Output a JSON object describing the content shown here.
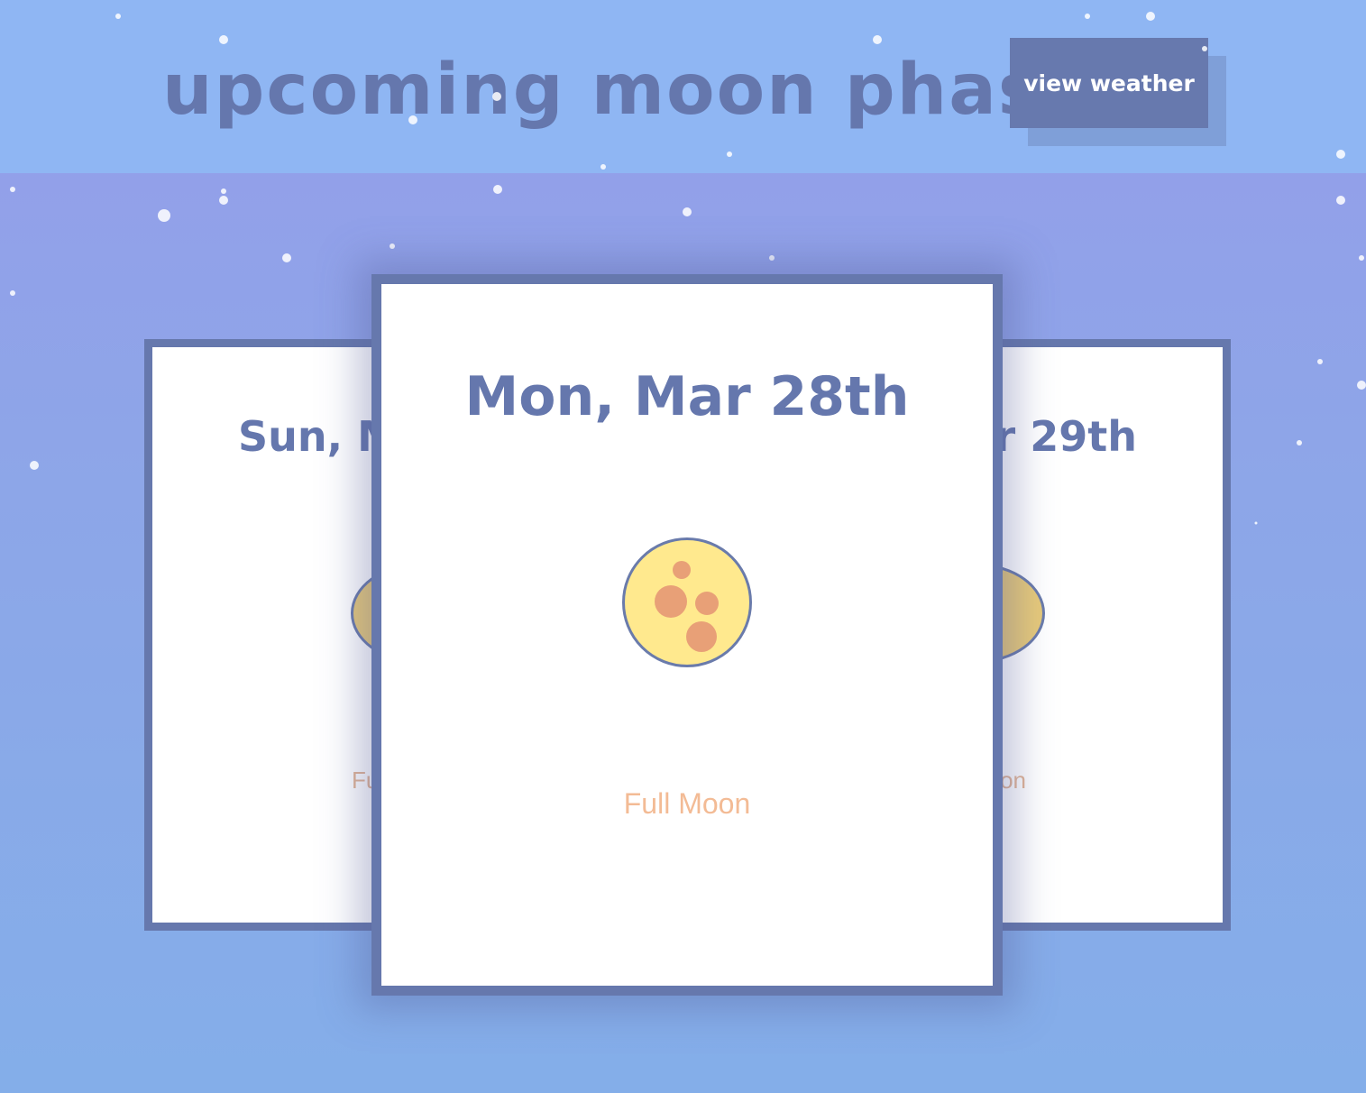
{
  "header": {
    "title": "upcoming moon phases",
    "button_label": "view weather"
  },
  "cards": {
    "left": {
      "date": "Sun, M",
      "phase": "Fu"
    },
    "main": {
      "date": "Mon, Mar 28th",
      "phase": "Full Moon"
    },
    "right": {
      "date": "r 29th",
      "phase": "on"
    }
  },
  "colors": {
    "accent": "#6577ad",
    "header_bg": "#8fb6f3",
    "moon": "#ffe98e",
    "crater": "#e8a077",
    "phase_text": "#f3bb95"
  },
  "icons": {
    "moon": "full-moon-icon",
    "stars": "star-dots"
  }
}
